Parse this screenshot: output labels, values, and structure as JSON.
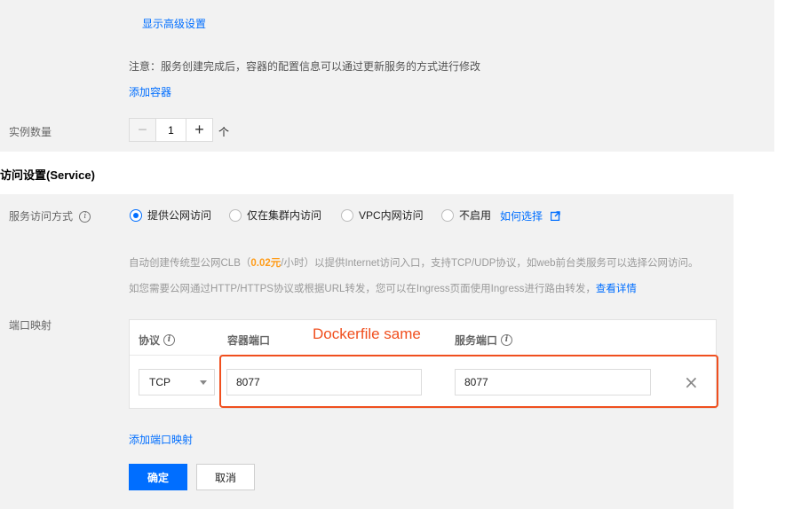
{
  "top": {
    "advanced_link": "显示高级设置",
    "notice": "注意：服务创建完成后，容器的配置信息可以通过更新服务的方式进行修改",
    "add_container": "添加容器",
    "instance_label": "实例数量",
    "instance_value": "1",
    "instance_unit": "个",
    "minus_symbol": "−",
    "plus_symbol": "+"
  },
  "service": {
    "section_title": "访问设置(Service)",
    "access_label": "服务访问方式",
    "options": [
      {
        "label": "提供公网访问",
        "selected": true
      },
      {
        "label": "仅在集群内访问",
        "selected": false
      },
      {
        "label": "VPC内网访问",
        "selected": false
      },
      {
        "label": "不启用",
        "selected": false
      }
    ],
    "how_to_choose": "如何选择",
    "desc1_prefix": "自动创建传统型公网CLB（",
    "desc1_price": "0.02元",
    "desc1_suffix": "/小时）以提供Internet访问入口，支持TCP/UDP协议，如web前台类服务可以选择公网访问。",
    "desc2": "如您需要公网通过HTTP/HTTPS协议或根据URL转发，您可以在Ingress页面使用Ingress进行路由转发，",
    "desc2_link": "查看详情"
  },
  "port_mapping": {
    "label": "端口映射",
    "col_protocol": "协议",
    "col_container_port": "容器端口",
    "col_service_port": "服务端口",
    "protocol_value": "TCP",
    "container_port": "8077",
    "service_port": "8077",
    "remove_symbol": "×",
    "add_link": "添加端口映射"
  },
  "actions": {
    "confirm": "确定",
    "cancel": "取消"
  },
  "annotation": {
    "text": "Dockerfile same",
    "color": "#f04f1e"
  },
  "colors": {
    "accent": "#006eff",
    "price": "#ff9c19",
    "panel_bg": "#f2f2f2"
  },
  "icons": {
    "info": "info-circle-icon",
    "external": "external-link-icon",
    "close": "close-icon",
    "caret": "caret-down-icon"
  }
}
